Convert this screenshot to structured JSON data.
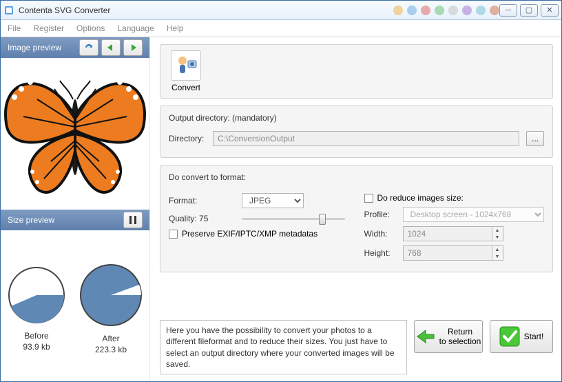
{
  "window": {
    "title": "Contenta SVG Converter"
  },
  "menu": {
    "file": "File",
    "register": "Register",
    "options": "Options",
    "language": "Language",
    "help": "Help"
  },
  "left": {
    "image_preview": "Image preview",
    "size_preview": "Size preview",
    "before_label": "Before",
    "before_size": "93.9 kb",
    "after_label": "After",
    "after_size": "223.3 kb"
  },
  "toolbar": {
    "convert": "Convert"
  },
  "output": {
    "group_label": "Output directory: (mandatory)",
    "dir_label": "Directory:",
    "dir_value": "C:\\ConversionOutput"
  },
  "format": {
    "group_label": "Do convert to format:",
    "format_label": "Format:",
    "format_value": "JPEG",
    "quality_label": "Quality: 75",
    "preserve_label": "Preserve EXIF/IPTC/XMP metadatas",
    "reduce_label": "Do reduce images size:",
    "profile_label": "Profile:",
    "profile_value": "Desktop screen - 1024x768",
    "width_label": "Width:",
    "width_value": "1024",
    "height_label": "Height:",
    "height_value": "768"
  },
  "footer": {
    "help": "Here you have the possibility to convert your photos to a different fileformat and to reduce their sizes. You just have to select an output directory where your converted images will be saved.",
    "return_line1": "Return",
    "return_line2": "to selection",
    "start": "Start!"
  }
}
